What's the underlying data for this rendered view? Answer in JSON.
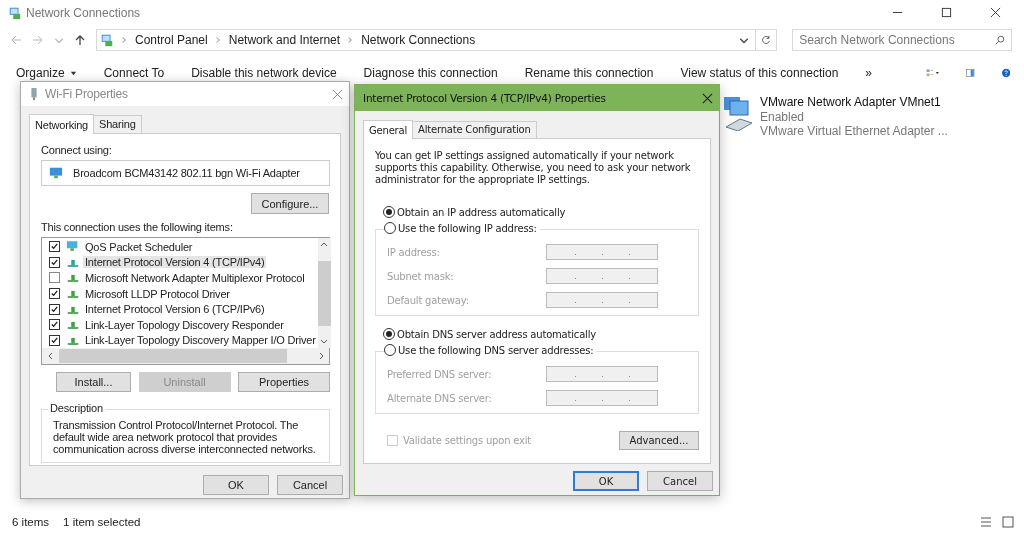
{
  "window": {
    "title": "Network Connections"
  },
  "address": {
    "crumbs": [
      "Control Panel",
      "Network and Internet",
      "Network Connections"
    ],
    "search_placeholder": "Search Network Connections"
  },
  "toolbar": {
    "items": [
      {
        "label": "Organize",
        "dropdown": true
      },
      {
        "label": "Connect To",
        "dropdown": false
      },
      {
        "label": "Disable this network device",
        "dropdown": false
      },
      {
        "label": "Diagnose this connection",
        "dropdown": false
      },
      {
        "label": "Rename this connection",
        "dropdown": false
      },
      {
        "label": "View status of this connection",
        "dropdown": false
      }
    ],
    "more": "»"
  },
  "connection": {
    "name": "VMware Network Adapter VMnet1",
    "status": "Enabled",
    "device": "VMware Virtual Ethernet Adapter ..."
  },
  "status_bar": {
    "count": "6 items",
    "selection": "1 item selected"
  },
  "wifi_dialog": {
    "title": "Wi-Fi Properties",
    "tabs": [
      {
        "label": "Networking",
        "selected": true
      },
      {
        "label": "Sharing",
        "selected": false
      }
    ],
    "connect_label": "Connect using:",
    "adapter": "Broadcom BCM43142 802.11 bgn Wi-Fi Adapter",
    "configure": "Configure...",
    "items_label": "This connection uses the following items:",
    "items": [
      {
        "label": "QoS Packet Scheduler",
        "checked": true,
        "selected": false,
        "kind": "scheduler"
      },
      {
        "label": "Internet Protocol Version 4 (TCP/IPv4)",
        "checked": true,
        "selected": true,
        "kind": "protocol"
      },
      {
        "label": "Microsoft Network Adapter Multiplexor Protocol",
        "checked": false,
        "selected": false,
        "kind": "protocol"
      },
      {
        "label": "Microsoft LLDP Protocol Driver",
        "checked": true,
        "selected": false,
        "kind": "protocol"
      },
      {
        "label": "Internet Protocol Version 6 (TCP/IPv6)",
        "checked": true,
        "selected": false,
        "kind": "protocol"
      },
      {
        "label": "Link-Layer Topology Discovery Responder",
        "checked": true,
        "selected": false,
        "kind": "protocol"
      },
      {
        "label": "Link-Layer Topology Discovery Mapper I/O Driver",
        "checked": true,
        "selected": false,
        "kind": "protocol"
      }
    ],
    "actions": [
      {
        "label": "Install...",
        "disabled": false
      },
      {
        "label": "Uninstall",
        "disabled": true
      },
      {
        "label": "Properties",
        "disabled": false
      }
    ],
    "description_title": "Description",
    "description": "Transmission Control Protocol/Internet Protocol. The default wide area network protocol that provides communication across diverse interconnected networks.",
    "buttons": [
      {
        "label": "OK",
        "default": false
      },
      {
        "label": "Cancel",
        "default": false
      }
    ]
  },
  "ipv4_dialog": {
    "title": "Internet Protocol Version 4 (TCP/IPv4) Properties",
    "tabs": [
      {
        "label": "General",
        "selected": true
      },
      {
        "label": "Alternate Configuration",
        "selected": false
      }
    ],
    "intro": "You can get IP settings assigned automatically if your network supports this capability. Otherwise, you need to ask your network administrator for the appropriate IP settings.",
    "ip_auto": {
      "label": "Obtain an IP address automatically",
      "selected": true
    },
    "ip_manual": {
      "label": "Use the following IP address:",
      "selected": false
    },
    "ip_fields": [
      {
        "label": "IP address:",
        "disabled": true
      },
      {
        "label": "Subnet mask:",
        "disabled": true
      },
      {
        "label": "Default gateway:",
        "disabled": true
      }
    ],
    "dns_auto": {
      "label": "Obtain DNS server address automatically",
      "selected": true
    },
    "dns_manual": {
      "label": "Use the following DNS server addresses:",
      "selected": false
    },
    "dns_fields": [
      {
        "label": "Preferred DNS server:",
        "disabled": true
      },
      {
        "label": "Alternate DNS server:",
        "disabled": true
      }
    ],
    "validate": {
      "label": "Validate settings upon exit",
      "checked": false,
      "disabled": true
    },
    "advanced": "Advanced...",
    "buttons": [
      {
        "label": "OK",
        "default": true
      },
      {
        "label": "Cancel",
        "default": false
      }
    ]
  }
}
